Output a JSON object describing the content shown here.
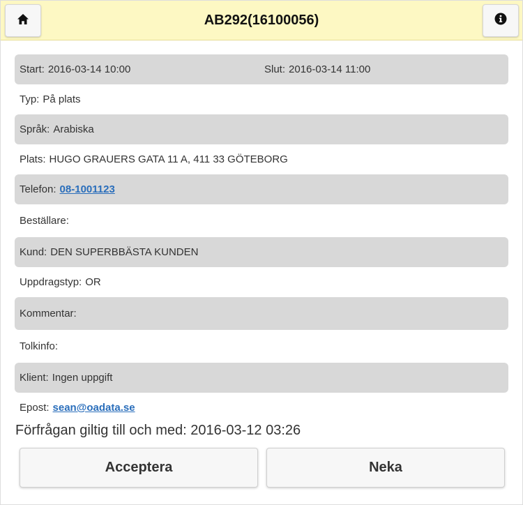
{
  "header": {
    "title": "AB292(16100056)",
    "home_icon": "home-icon",
    "info_icon": "info-icon"
  },
  "details": {
    "start": {
      "label": "Start:",
      "value": "2016-03-14 10:00"
    },
    "end": {
      "label": "Slut:",
      "value": "2016-03-14 11:00"
    },
    "type": {
      "label": "Typ:",
      "value": "På plats"
    },
    "language": {
      "label": "Språk:",
      "value": "Arabiska"
    },
    "place": {
      "label": "Plats:",
      "value": "HUGO GRAUERS GATA 11 A, 411 33 GÖTEBORG"
    },
    "phone": {
      "label": "Telefon:",
      "value": "08-1001123"
    },
    "orderer": {
      "label": "Beställare:",
      "value": ""
    },
    "customer": {
      "label": "Kund:",
      "value": "DEN SUPERBBÄSTA KUNDEN"
    },
    "assignment_type": {
      "label": "Uppdragstyp:",
      "value": "OR"
    },
    "comment": {
      "label": "Kommentar:",
      "value": ""
    },
    "interpreter_info": {
      "label": "Tolkinfo:",
      "value": ""
    },
    "client": {
      "label": "Klient:",
      "value": "Ingen uppgift"
    },
    "email": {
      "label": "Epost:",
      "value": "sean@oadata.se"
    }
  },
  "validity": {
    "label": "Förfrågan giltig till och med:",
    "value": "2016-03-12 03:26"
  },
  "actions": {
    "accept_label": "Acceptera",
    "decline_label": "Neka"
  },
  "colors": {
    "header_bg": "#fdf8c3",
    "row_shade": "#d8d8d8",
    "link": "#2a6ebb"
  }
}
